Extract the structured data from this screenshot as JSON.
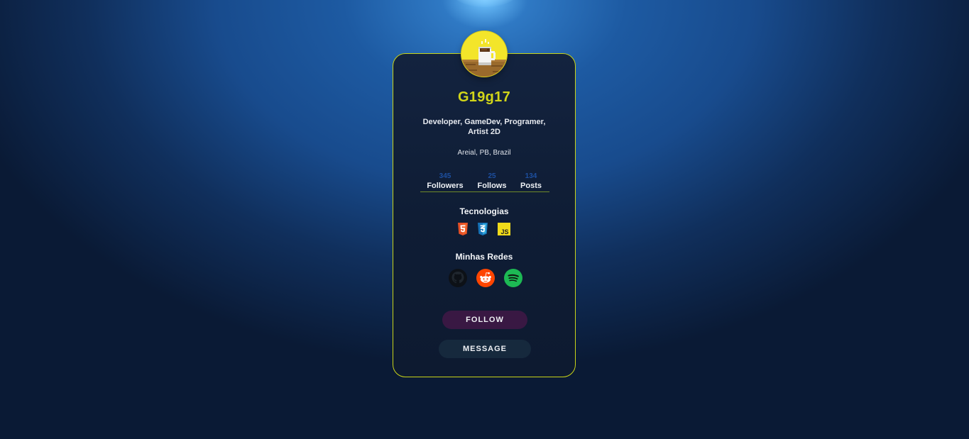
{
  "profile": {
    "username": "G19g17",
    "bio": "Developer, GameDev, Programer, Artist 2D",
    "location": "Areial, PB, Brazil",
    "avatar_icon": "pixel-coffee-cup-icon"
  },
  "stats": [
    {
      "value": "345",
      "label": "Followers"
    },
    {
      "value": "25",
      "label": "Follows"
    },
    {
      "value": "134",
      "label": "Posts"
    }
  ],
  "technologies": {
    "title": "Tecnologias",
    "icons": [
      "html5-icon",
      "css3-icon",
      "javascript-icon"
    ],
    "js_text": "JS"
  },
  "networks": {
    "title": "Minhas Redes",
    "icons": [
      "github-icon",
      "reddit-icon",
      "spotify-icon"
    ]
  },
  "buttons": {
    "follow": "FOLLOW",
    "message": "MESSAGE"
  },
  "colors": {
    "accent": "#d2d619",
    "card_border": "#c9d418",
    "stat_value": "#1d4fa0",
    "follow_bg": "#391843",
    "message_bg": "#16293d"
  }
}
